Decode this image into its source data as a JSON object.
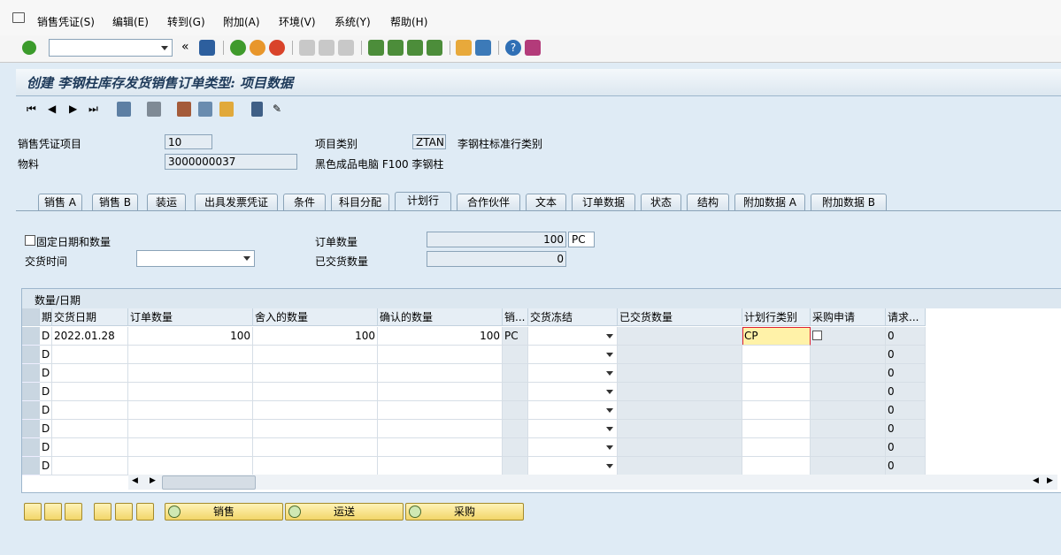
{
  "menu": [
    "销售凭证(S)",
    "编辑(E)",
    "转到(G)",
    "附加(A)",
    "环境(V)",
    "系统(Y)",
    "帮助(H)"
  ],
  "title": "创建 李钢柱库存发货销售订单类型: 项目数据",
  "header": {
    "item_label": "销售凭证项目",
    "item_value": "10",
    "category_label": "项目类别",
    "category_value": "ZTAN",
    "category_desc": "李钢柱标准行类别",
    "material_label": "物料",
    "material_value": "3000000037",
    "material_desc": "黑色成品电脑 F100 李钢柱"
  },
  "tabs": [
    "销售 A",
    "销售 B",
    "装运",
    "出具发票凭证",
    "条件",
    "科目分配",
    "计划行",
    "合作伙伴",
    "文本",
    "订单数据",
    "状态",
    "结构",
    "附加数据 A",
    "附加数据 B"
  ],
  "active_tab": "计划行",
  "schedule": {
    "fixed_label": "固定日期和数量",
    "delivery_time_label": "交货时间",
    "order_qty_label": "订单数量",
    "order_qty_value": "100",
    "order_qty_unit": "PC",
    "delivered_qty_label": "已交货数量",
    "delivered_qty_value": "0"
  },
  "table": {
    "title": "数量/日期",
    "columns": [
      "期",
      "交货日期",
      "订单数量",
      "舍入的数量",
      "确认的数量",
      "销...",
      "交货冻结",
      "已交货数量",
      "计划行类别",
      "采购申请",
      "请求..."
    ],
    "rows": [
      {
        "p": "D",
        "date": "2022.01.28",
        "qty": "100",
        "round": "100",
        "conf": "100",
        "unit": "PC",
        "cat": "CP",
        "req": "0"
      },
      {
        "p": "D",
        "date": "",
        "qty": "",
        "round": "",
        "conf": "",
        "unit": "",
        "cat": "",
        "req": "0"
      },
      {
        "p": "D",
        "date": "",
        "qty": "",
        "round": "",
        "conf": "",
        "unit": "",
        "cat": "",
        "req": "0"
      },
      {
        "p": "D",
        "date": "",
        "qty": "",
        "round": "",
        "conf": "",
        "unit": "",
        "cat": "",
        "req": "0"
      },
      {
        "p": "D",
        "date": "",
        "qty": "",
        "round": "",
        "conf": "",
        "unit": "",
        "cat": "",
        "req": "0"
      },
      {
        "p": "D",
        "date": "",
        "qty": "",
        "round": "",
        "conf": "",
        "unit": "",
        "cat": "",
        "req": "0"
      },
      {
        "p": "D",
        "date": "",
        "qty": "",
        "round": "",
        "conf": "",
        "unit": "",
        "cat": "",
        "req": "0"
      },
      {
        "p": "D",
        "date": "",
        "qty": "",
        "round": "",
        "conf": "",
        "unit": "",
        "cat": "",
        "req": "0"
      }
    ]
  },
  "buttons": {
    "sales": "销售",
    "shipping": "运送",
    "procurement": "采购"
  }
}
